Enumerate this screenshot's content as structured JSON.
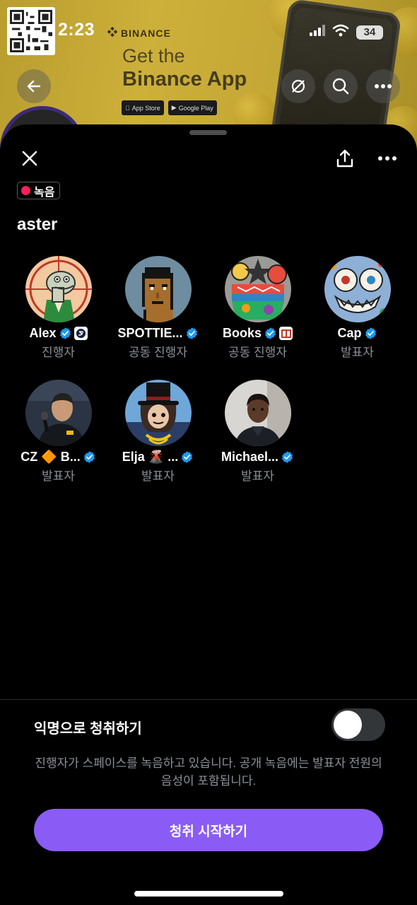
{
  "status_bar": {
    "time": "2:23",
    "battery": "34"
  },
  "banner": {
    "brand": "BINANCE",
    "line1": "Get the",
    "line2": "Binance App",
    "app_store_label": "App Store",
    "google_play_label": "Google Play"
  },
  "sheet": {
    "recording_label": "녹음",
    "title": "aster",
    "participants": [
      {
        "name": "Alex",
        "role": "진행자",
        "verified": true,
        "avatar": "cartoon-dinosaur-avatar"
      },
      {
        "name": "SPOTTIE...",
        "role": "공동 진행자",
        "verified": true,
        "avatar": "pixel-punk-avatar"
      },
      {
        "name": "Books",
        "role": "공동 진행자",
        "verified": true,
        "avatar": "colorful-art-avatar"
      },
      {
        "name": "Cap",
        "role": "발표자",
        "verified": true,
        "avatar": "abstract-art-avatar"
      },
      {
        "name": "CZ 🔶 B...",
        "role": "발표자",
        "verified": true,
        "avatar": "speaker-photo-avatar"
      },
      {
        "name": "Elja 🌋 ...",
        "role": "발표자",
        "verified": true,
        "avatar": "top-hat-cartoon-avatar"
      },
      {
        "name": "Michael...",
        "role": "발표자",
        "verified": true,
        "avatar": "portrait-photo-avatar"
      }
    ],
    "anonymous_label": "익명으로 청취하기",
    "anonymous_enabled": false,
    "notice": "진행자가 스페이스를 녹음하고 있습니다. 공개 녹음에는 발표자 전원의 음성이 포함됩니다.",
    "start_button": "청취 시작하기"
  },
  "colors": {
    "accent": "#8a5cf5",
    "verified": "#1d9bf0",
    "recording": "#f4215a",
    "secondary_text": "#8b9097"
  }
}
